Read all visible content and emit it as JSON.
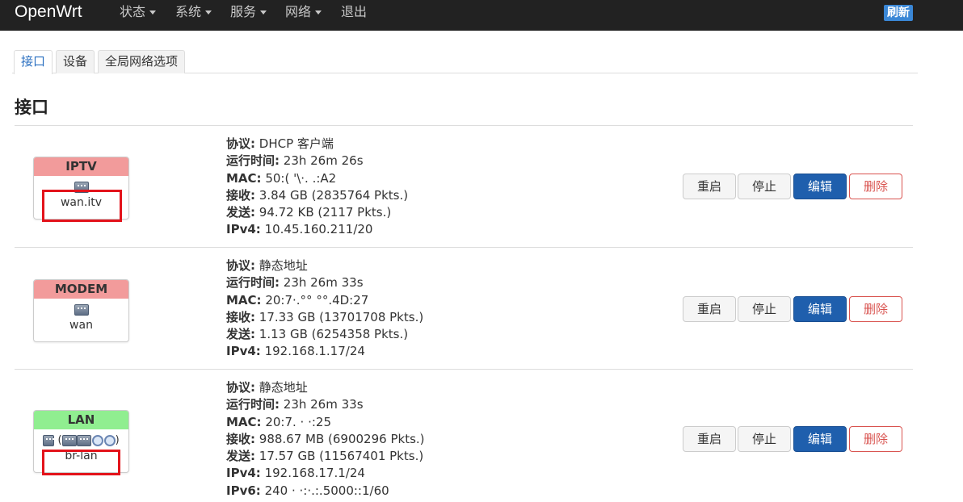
{
  "nav": {
    "brand": "OpenWrt",
    "items": [
      {
        "label": "状态",
        "has_caret": true
      },
      {
        "label": "系统",
        "has_caret": true
      },
      {
        "label": "服务",
        "has_caret": true
      },
      {
        "label": "网络",
        "has_caret": true
      },
      {
        "label": "退出",
        "has_caret": false
      }
    ],
    "refresh_label": "刷新"
  },
  "tabs": [
    {
      "label": "接口",
      "active": true
    },
    {
      "label": "设备",
      "active": false
    },
    {
      "label": "全局网络选项",
      "active": false
    }
  ],
  "section_title": "接口",
  "interfaces": [
    {
      "name": "IPTV",
      "head_color": "#f29b9b",
      "device": "wan.itv",
      "highlighted": true,
      "status": {
        "protocol_label": "协议:",
        "protocol": "DHCP 客户端",
        "uptime_label": "运行时间:",
        "uptime": "23h 26m 26s",
        "mac_label": "MAC:",
        "mac": "50:( '\\·. .:A2",
        "rx_label": "接收:",
        "rx": "3.84 GB (2835764 Pkts.)",
        "tx_label": "发送:",
        "tx": "94.72 KB (2117 Pkts.)",
        "ipv4_label": "IPv4:",
        "ipv4": "10.45.160.211/20"
      }
    },
    {
      "name": "MODEM",
      "head_color": "#f29b9b",
      "device": "wan",
      "highlighted": false,
      "status": {
        "protocol_label": "协议:",
        "protocol": "静态地址",
        "uptime_label": "运行时间:",
        "uptime": "23h 26m 33s",
        "mac_label": "MAC:",
        "mac": "20:7·.°° °°.4D:27",
        "rx_label": "接收:",
        "rx": "17.33 GB (13701708 Pkts.)",
        "tx_label": "发送:",
        "tx": "1.13 GB (6254358 Pkts.)",
        "ipv4_label": "IPv4:",
        "ipv4": "192.168.1.17/24"
      }
    },
    {
      "name": "LAN",
      "head_color": "#90ee90",
      "device": "br-lan",
      "highlighted": true,
      "status": {
        "protocol_label": "协议:",
        "protocol": "静态地址",
        "uptime_label": "运行时间:",
        "uptime": "23h 26m 33s",
        "mac_label": "MAC:",
        "mac": "20:7. · ·:25",
        "rx_label": "接收:",
        "rx": "988.67 MB (6900296 Pkts.)",
        "tx_label": "发送:",
        "tx": "17.57 GB (11567401 Pkts.)",
        "ipv4_label": "IPv4:",
        "ipv4": "192.168.17.1/24",
        "ipv6_label": "IPv6:",
        "ipv6": "240 · ·:·.:.5000::1/60"
      }
    }
  ],
  "actions": {
    "restart": "重启",
    "stop": "停止",
    "edit": "编辑",
    "delete": "删除"
  },
  "colors": {
    "navbar": "#222222",
    "edit_button": "#1f5fad",
    "delete_border": "#d9534f",
    "highlight": "#e3131b",
    "refresh_badge": "#3a87d6"
  }
}
